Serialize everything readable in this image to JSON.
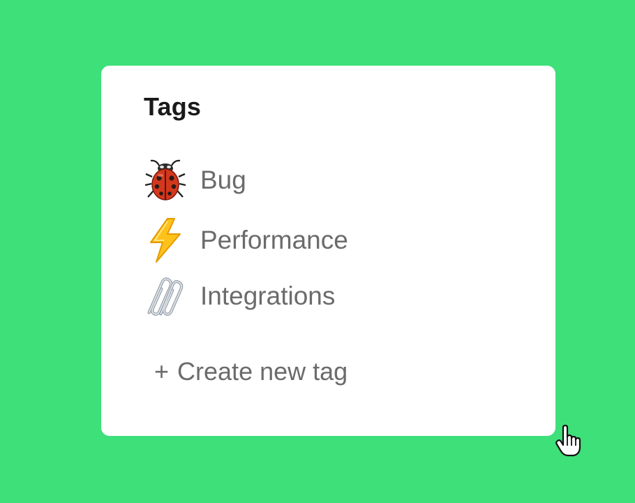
{
  "card": {
    "title": "Tags"
  },
  "tags": [
    {
      "label": "Bug",
      "icon": "ladybug-icon"
    },
    {
      "label": "Performance",
      "icon": "lightning-icon"
    },
    {
      "label": "Integrations",
      "icon": "paperclips-icon"
    }
  ],
  "create_tag": {
    "plus": "+",
    "label": "Create new tag"
  },
  "colors": {
    "background": "#3ee07a",
    "card": "#ffffff",
    "title": "#1a1a1a",
    "label": "#6b6b6b"
  }
}
